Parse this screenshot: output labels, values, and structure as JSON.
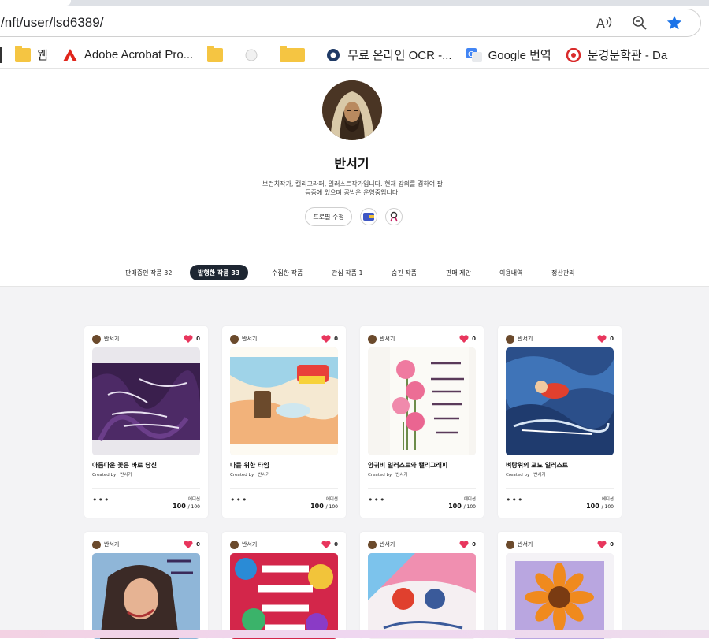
{
  "browser": {
    "url": "/nft/user/lsd6389/",
    "bookmarks": [
      {
        "label": "웹",
        "icon": "folder-icon"
      },
      {
        "label": "Adobe Acrobat Pro...",
        "icon": "adobe-acrobat-icon"
      },
      {
        "label": "",
        "icon": "folder-icon"
      },
      {
        "label": "",
        "icon": "globe-icon"
      },
      {
        "label": "",
        "icon": "folder-icon"
      },
      {
        "label": "무료 온라인 OCR -...",
        "icon": "ocr-icon"
      },
      {
        "label": "Google 번역",
        "icon": "google-translate-icon"
      },
      {
        "label": "문경문학관 - Da",
        "icon": "site-icon"
      }
    ]
  },
  "profile": {
    "name": "반서기",
    "bio_line1": "브런치작가, 캘리그라퍼, 일러스트작가입니다. 현재 강의를 겸하여 팔",
    "bio_line2": "등중에 있으며 공방은 운영중입니다.",
    "edit_label": "프로필 수정"
  },
  "tabs": [
    {
      "label": "판매중인 작품 32",
      "active": false
    },
    {
      "label": "발행한 작품 33",
      "active": true
    },
    {
      "label": "수집한 작품",
      "active": false
    },
    {
      "label": "관심 작품 1",
      "active": false
    },
    {
      "label": "숨긴 작품",
      "active": false
    },
    {
      "label": "판매 제안",
      "active": false
    },
    {
      "label": "이용내역",
      "active": false
    },
    {
      "label": "정산관리",
      "active": false
    }
  ],
  "card_common": {
    "owner": "반서기",
    "likes": "0",
    "created_by_label": "Created by",
    "creator": "반서기",
    "more": "•••",
    "edition_label": "에디션",
    "edition_count": "100",
    "edition_total": "/ 100"
  },
  "cards": [
    {
      "title": "아름다운 꽃은 바로 당신",
      "art": "purple-leaves-calligraphy"
    },
    {
      "title": "나를 위한 타임",
      "art": "cafe-drink-illustration"
    },
    {
      "title": "양귀비 일러스트와 캘리그래피",
      "art": "pink-poppies-calligraphy"
    },
    {
      "title": "벼랑위의 포뇨 일러스트",
      "art": "ponyo-wave-illustration"
    },
    {
      "title": "",
      "art": "woman-portrait-illustration"
    },
    {
      "title": "",
      "art": "colorful-lettering"
    },
    {
      "title": "",
      "art": "ponyo-kiss-illustration"
    },
    {
      "title": "",
      "art": "sunflower-illustration"
    }
  ],
  "colors": {
    "active_tab_bg": "#1e2632",
    "heart": "#e8365d",
    "star": "#1a73e8"
  }
}
